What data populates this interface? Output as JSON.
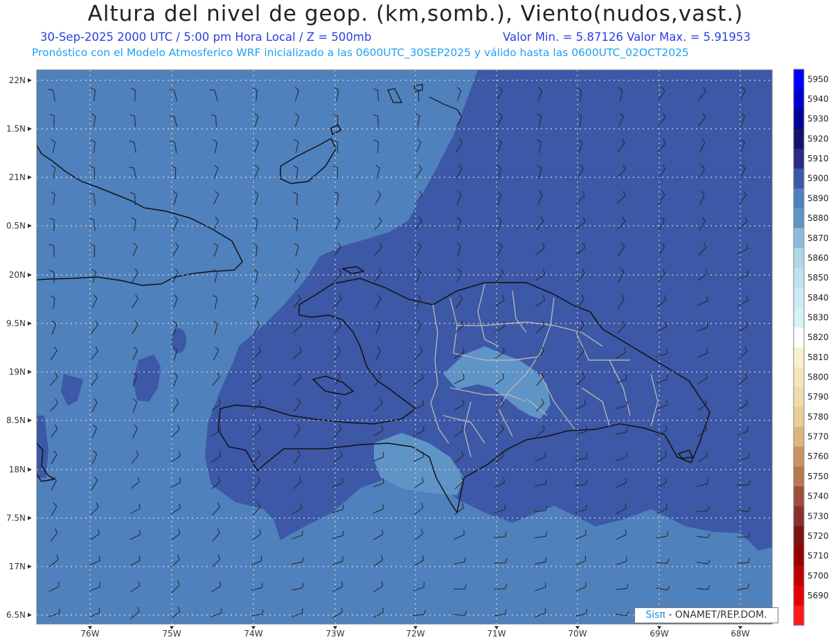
{
  "header": {
    "title": "Altura del nivel de geop. (km,somb.), Viento(nudos,vast.)",
    "line1_left": "30-Sep-2025  2000 UTC / 5:00 pm Hora Local / Z = 500mb",
    "line1_right": "Valor Min. = 5.87126  Valor Max. = 5.91953",
    "line2": "Pronóstico con el Modelo Atmosferico WRF inicializado a las 0600UTC_30SEP2025 y válido hasta las  0600UTC_02OCT2025"
  },
  "credit": {
    "logo": "Sisπ",
    "text": "- ONAMET/REP.DOM."
  },
  "map": {
    "lat_labels": [
      "22N",
      "1.5N",
      "21N",
      "0.5N",
      "20N",
      "9.5N",
      "19N",
      "8.5N",
      "18N",
      "7.5N",
      "17N",
      "6.5N"
    ],
    "lon_labels": [
      "76W",
      "75W",
      "74W",
      "73W",
      "72W",
      "71W",
      "70W",
      "69W",
      "68W"
    ],
    "lat_range": [
      16.4,
      22.1
    ],
    "lon_range": [
      -76.65,
      -67.62
    ]
  },
  "colors": {
    "field_5890": "#4f81bd",
    "field_5900": "#3c58a6",
    "field_5880": "#5f94c7",
    "coast": "#111111",
    "provinces": "#b4b4b4",
    "grid": "#d8d8d8"
  },
  "legend": {
    "levels": [
      {
        "value": "5950",
        "color": "#0000ff"
      },
      {
        "value": "5940",
        "color": "#0000cc"
      },
      {
        "value": "5930",
        "color": "#000099"
      },
      {
        "value": "5920",
        "color": "#14126b"
      },
      {
        "value": "5910",
        "color": "#2a2a8a"
      },
      {
        "value": "5900",
        "color": "#3c58a6"
      },
      {
        "value": "5890",
        "color": "#4f81bd"
      },
      {
        "value": "5880",
        "color": "#5f94c7"
      },
      {
        "value": "5870",
        "color": "#8fbadc"
      },
      {
        "value": "5860",
        "color": "#aed8e8"
      },
      {
        "value": "5850",
        "color": "#bfe3ef"
      },
      {
        "value": "5840",
        "color": "#cdebf4"
      },
      {
        "value": "5830",
        "color": "#d3f3f7"
      },
      {
        "value": "5820",
        "color": "#ffffff"
      },
      {
        "value": "5810",
        "color": "#faf0cc"
      },
      {
        "value": "5800",
        "color": "#f5e7bd"
      },
      {
        "value": "5790",
        "color": "#efdcaa"
      },
      {
        "value": "5780",
        "color": "#e8cd98"
      },
      {
        "value": "5770",
        "color": "#ddb47c"
      },
      {
        "value": "5760",
        "color": "#c99463"
      },
      {
        "value": "5750",
        "color": "#b8784f"
      },
      {
        "value": "5740",
        "color": "#9e503d"
      },
      {
        "value": "5730",
        "color": "#8a2e2e"
      },
      {
        "value": "5720",
        "color": "#7a1414"
      },
      {
        "value": "5710",
        "color": "#960000"
      },
      {
        "value": "5700",
        "color": "#c00000"
      },
      {
        "value": "5690",
        "color": "#e60000"
      },
      {
        "value": "",
        "color": "#ff1a1a"
      }
    ]
  }
}
